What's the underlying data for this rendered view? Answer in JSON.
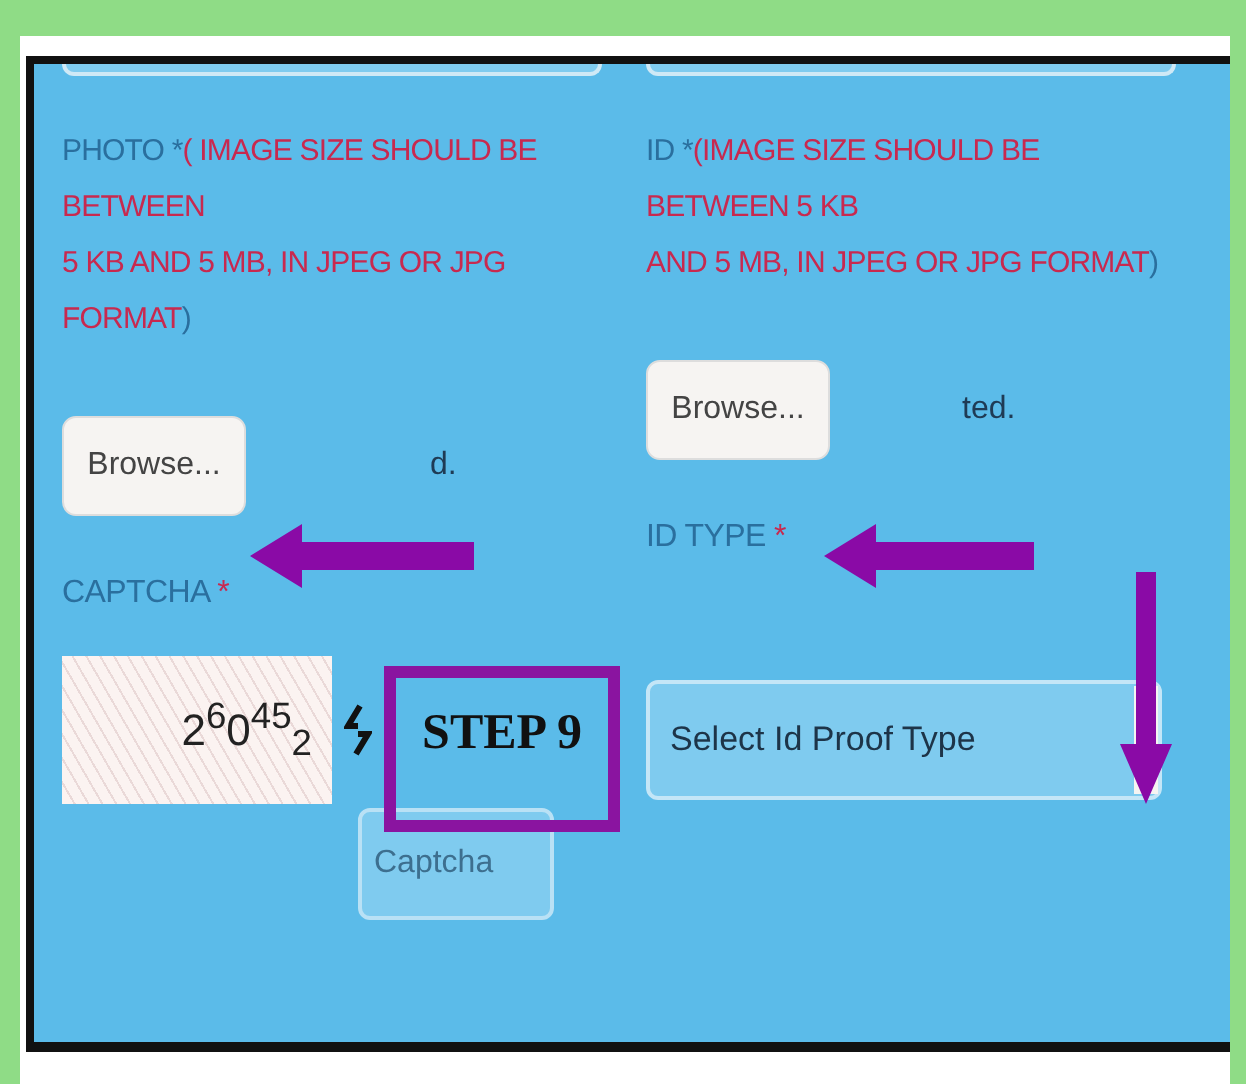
{
  "photo": {
    "label": "PHOTO *",
    "note": [
      "( IMAGE SIZE SHOULD BE BETWEEN",
      "5 KB AND 5 MB, IN JPEG OR JPG FORMAT"
    ],
    "close": ")",
    "button": "Browse...",
    "status": "d."
  },
  "id_proof": {
    "label": "ID *",
    "note": [
      "(IMAGE SIZE SHOULD BE BETWEEN 5 KB",
      "AND 5 MB, IN JPEG OR JPG FORMAT"
    ],
    "close": ")",
    "button": "Browse...",
    "status": "ted."
  },
  "captcha": {
    "label": "CAPTCHA",
    "required": "*",
    "code": "2$^{6}$0$^{45}$$_{2}$",
    "placeholder": "Captcha"
  },
  "id_type": {
    "label": "ID TYPE",
    "required": "*",
    "select": "Select Id Proof Type"
  },
  "annotation": {
    "text": "STEP 9"
  }
}
